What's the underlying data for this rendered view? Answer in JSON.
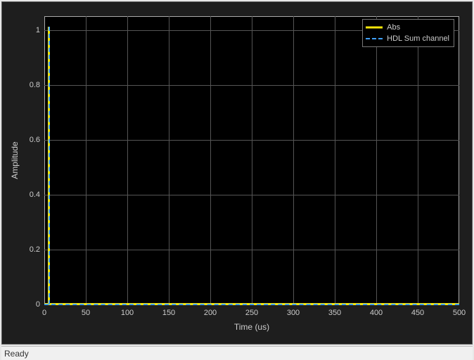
{
  "window": {
    "status": "Ready"
  },
  "chart_data": {
    "type": "line",
    "title": "",
    "xlabel": "Time (us)",
    "ylabel": "Amplitude",
    "xlim": [
      0,
      500
    ],
    "ylim": [
      0,
      1.05
    ],
    "x_ticks": [
      0,
      50,
      100,
      150,
      200,
      250,
      300,
      350,
      400,
      450,
      500
    ],
    "y_ticks": [
      0,
      0.2,
      0.4,
      0.6,
      0.8,
      1
    ],
    "series": [
      {
        "name": "Abs",
        "style": "solid",
        "color": "#f5e60a",
        "x": [
          5,
          5,
          500
        ],
        "y": [
          0.96,
          0.0,
          0.0
        ]
      },
      {
        "name": "HDL Sum channel",
        "style": "dashed",
        "color": "#3ea0ff",
        "x": [
          5,
          5,
          500
        ],
        "y": [
          0.96,
          0.0,
          0.0
        ]
      }
    ],
    "legend": {
      "position": "top-right",
      "items": [
        {
          "label": "Abs"
        },
        {
          "label": "HDL Sum channel"
        }
      ]
    }
  }
}
